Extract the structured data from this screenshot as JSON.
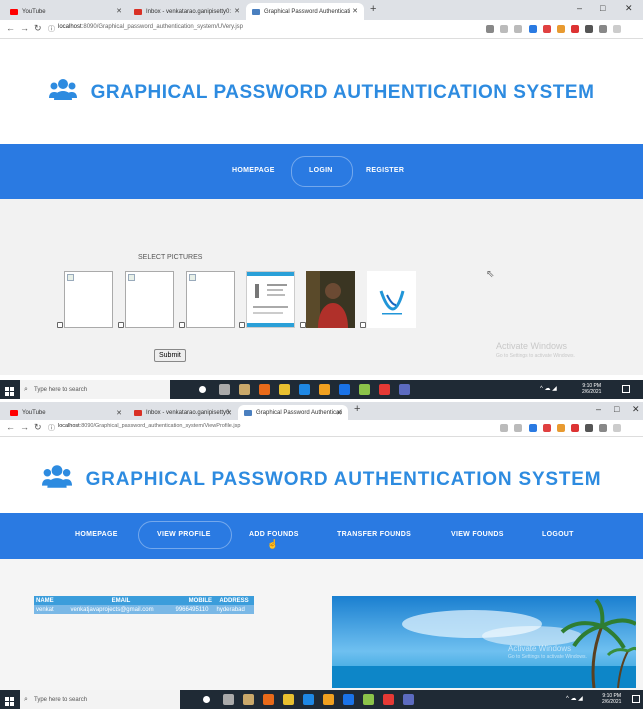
{
  "screen1": {
    "tabs": [
      {
        "label": "YouTube",
        "favicon_color": "#ff0000"
      },
      {
        "label": "Inbox - venkatarao.ganipisetty0:",
        "favicon_color": "#d93025"
      },
      {
        "label": "Graphical Password Authenticati",
        "favicon_color": "#4a7fbf"
      }
    ],
    "new_tab": "+",
    "window_controls": [
      "–",
      "□",
      "✕"
    ],
    "url_host": "localhost",
    "url_path": ":8090/Graphical_password_authentication_system/UVery.jsp",
    "site_title": "GRAPHICAL PASSWORD AUTHENTICATION SYSTEM",
    "nav": [
      "HOMEPAGE",
      "LOGIN",
      "REGISTER"
    ],
    "active_nav": "LOGIN",
    "select_label": "SELECT PICTURES",
    "submit_label": "Submit",
    "watermark_title": "Activate Windows",
    "watermark_sub": "Go to Settings to activate Windows.",
    "search_placeholder": "Type here to search",
    "clock_time": "9:10 PM",
    "clock_date": "2/6/2021",
    "brand_color": "#2a7ae2"
  },
  "screen2": {
    "tabs": [
      {
        "label": "YouTube",
        "favicon_color": "#ff0000"
      },
      {
        "label": "Inbox - venkatarao.ganipisetty0:",
        "favicon_color": "#d93025"
      },
      {
        "label": "Graphical Password Authenticati",
        "favicon_color": "#4a7fbf"
      }
    ],
    "url_host": "localhost",
    "url_path": ":8090/Graphical_password_authentication_system/ViewProfile.jsp",
    "site_title": "GRAPHICAL PASSWORD AUTHENTICATION SYSTEM",
    "nav": [
      "HOMEPAGE",
      "VIEW PROFILE",
      "ADD FOUNDS",
      "TRANSFER FOUNDS",
      "VIEW FOUNDS",
      "LOGOUT"
    ],
    "active_nav": "VIEW PROFILE",
    "profile_table": {
      "headers": [
        "NAME",
        "EMAIL",
        "MOBILE",
        "ADDRESS"
      ],
      "rows": [
        [
          "venkat",
          "venkatjavaprojects@gmail.com",
          "9966495110",
          "hyderabad"
        ]
      ]
    },
    "watermark_title": "Activate Windows",
    "watermark_sub": "Go to Settings to activate Windows.",
    "search_placeholder": "Type here to search",
    "clock_time": "9:10 PM",
    "clock_date": "2/6/2021"
  }
}
